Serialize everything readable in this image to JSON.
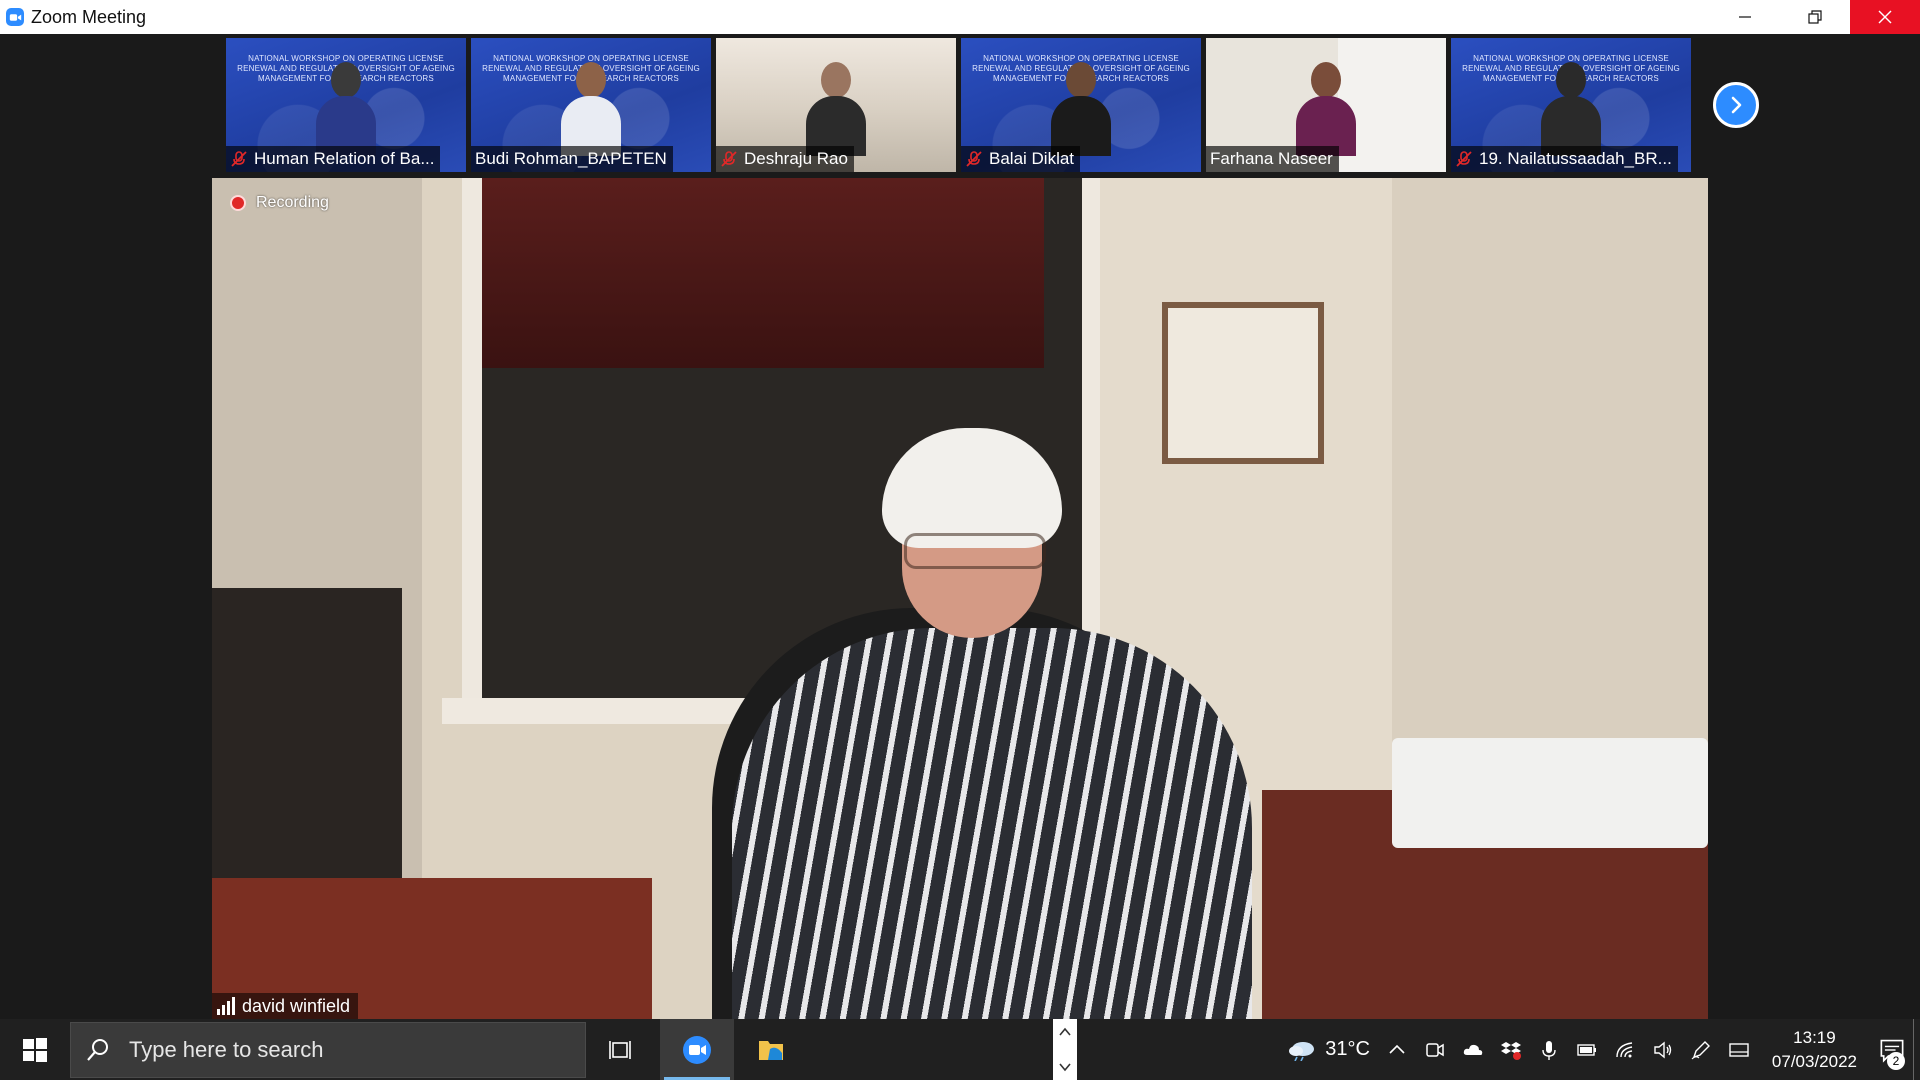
{
  "window": {
    "title": "Zoom Meeting"
  },
  "gallery": {
    "tiles": [
      {
        "name": "Human Relation of Ba...",
        "muted": true,
        "banner": "NATIONAL WORKSHOP ON OPERATING LICENSE RENEWAL AND REGULATORY OVERSIGHT OF AGEING MANAGEMENT FOR RESEARCH REACTORS"
      },
      {
        "name": "Budi Rohman_BAPETEN",
        "muted": false,
        "banner": "NATIONAL WORKSHOP ON OPERATING LICENSE RENEWAL AND REGULATORY OVERSIGHT OF AGEING MANAGEMENT FOR RESEARCH REACTORS"
      },
      {
        "name": "Deshraju Rao",
        "muted": true,
        "banner": ""
      },
      {
        "name": "Balai Diklat",
        "muted": true,
        "banner": "NATIONAL WORKSHOP ON OPERATING LICENSE RENEWAL AND REGULATORY OVERSIGHT OF AGEING MANAGEMENT FOR RESEARCH REACTORS"
      },
      {
        "name": "Farhana Naseer",
        "muted": false,
        "banner": ""
      },
      {
        "name": "19. Nailatussaadah_BR...",
        "muted": true,
        "banner": "NATIONAL WORKSHOP ON OPERATING LICENSE RENEWAL AND REGULATORY OVERSIGHT OF AGEING MANAGEMENT FOR RESEARCH REACTORS"
      }
    ]
  },
  "main_video": {
    "recording_label": "Recording",
    "speaker_name": "david winfield"
  },
  "taskbar": {
    "search_placeholder": "Type here to search",
    "weather_temp": "31°C",
    "time": "13:19",
    "date": "07/03/2022",
    "notification_count": "2"
  },
  "colors": {
    "zoom_blue": "#2d8cff",
    "close_red": "#e81123",
    "taskbar_bg": "#202020",
    "recording_red": "#e02828"
  }
}
